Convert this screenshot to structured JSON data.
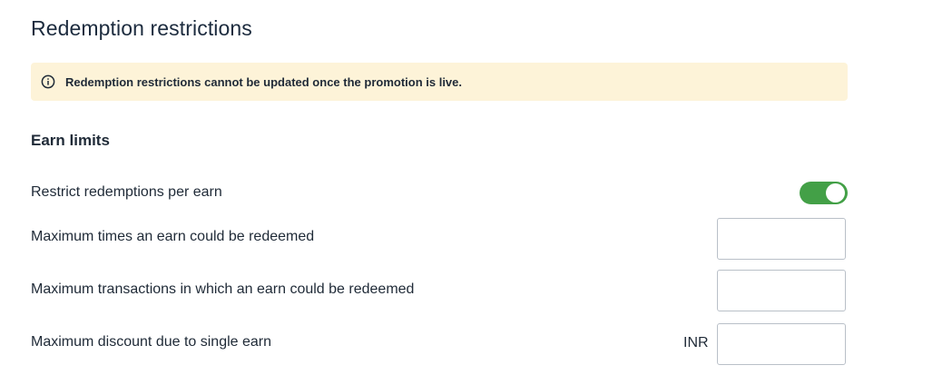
{
  "section": {
    "title": "Redemption restrictions"
  },
  "alert": {
    "icon": "info-icon",
    "text": "Redemption restrictions cannot be updated once the promotion is live."
  },
  "earn_limits": {
    "heading": "Earn limits",
    "restrict_toggle": {
      "label": "Restrict redemptions per earn",
      "checked": true,
      "color": "#43a047"
    },
    "max_times": {
      "label": "Maximum times an earn could be redeemed",
      "value": ""
    },
    "max_transactions": {
      "label": "Maximum transactions in which an earn could be redeemed",
      "value": ""
    },
    "max_discount": {
      "label": "Maximum discount due to single earn",
      "currency": "INR",
      "value": ""
    }
  }
}
